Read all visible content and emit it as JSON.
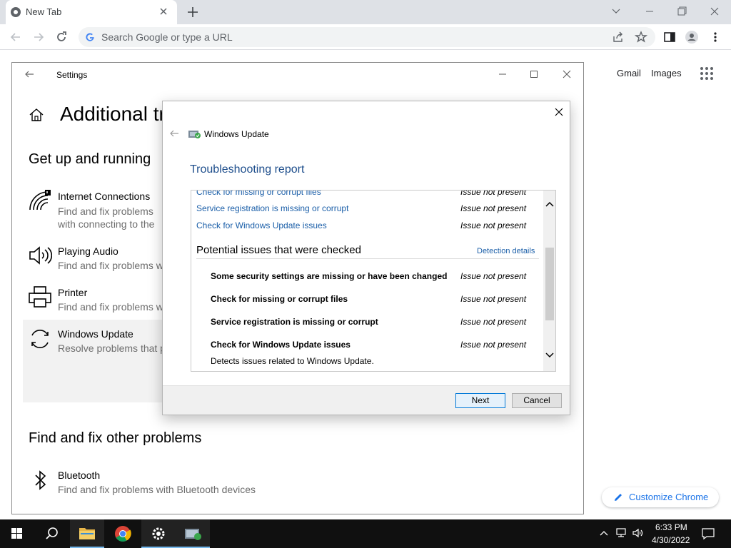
{
  "browser": {
    "tab_title": "New Tab",
    "omnibox_placeholder": "Search Google or type a URL",
    "ntp": {
      "gmail": "Gmail",
      "images": "Images",
      "customize": "Customize Chrome"
    }
  },
  "settings": {
    "window_title": "Settings",
    "page_title": "Additional troubleshooters",
    "section1": "Get up and running",
    "items": [
      {
        "name": "Internet Connections",
        "desc": "Find and fix problems with connecting to the Internet or to websites.",
        "icon": "wifi-icon"
      },
      {
        "name": "Playing Audio",
        "desc": "Find and fix problems with playing sound",
        "icon": "speaker-icon"
      },
      {
        "name": "Printer",
        "desc": "Find and fix problems with printing",
        "icon": "printer-icon"
      },
      {
        "name": "Windows Update",
        "desc": "Resolve problems that prevent you from updating Windows",
        "icon": "refresh-icon"
      }
    ],
    "section2": "Find and fix other problems",
    "other_items": [
      {
        "name": "Bluetooth",
        "desc": "Find and fix problems with Bluetooth devices",
        "icon": "bluetooth-icon"
      }
    ]
  },
  "dialog": {
    "app_title": "Windows Update",
    "heading": "Troubleshooting report",
    "found_rows": [
      {
        "label": "Check for missing or corrupt files",
        "status": "Issue not present"
      },
      {
        "label": "Service registration is missing or corrupt",
        "status": "Issue not present"
      },
      {
        "label": "Check for Windows Update issues",
        "status": "Issue not present"
      }
    ],
    "section_title": "Potential issues that were checked",
    "details_link": "Detection details",
    "checked_rows": [
      {
        "label": "Some security settings are missing or have been changed",
        "status": "Issue not present"
      },
      {
        "label": "Check for missing or corrupt files",
        "status": "Issue not present"
      },
      {
        "label": "Service registration is missing or corrupt",
        "status": "Issue not present"
      },
      {
        "label": "Check for Windows Update issues",
        "status": "Issue not present"
      }
    ],
    "last_desc": "Detects issues related to Windows Update.",
    "next_label": "Next",
    "cancel_label": "Cancel"
  },
  "taskbar": {
    "time": "6:33 PM",
    "date": "4/30/2022",
    "apps": [
      "start-icon",
      "search-icon",
      "file-explorer-icon",
      "chrome-icon",
      "settings-gear-icon",
      "troubleshooter-icon"
    ]
  },
  "colors": {
    "link_blue": "#1a5ea8",
    "heading_blue": "#1e4e8c",
    "chrome_tabstrip": "#dee1e6",
    "taskbar": "#101010"
  }
}
